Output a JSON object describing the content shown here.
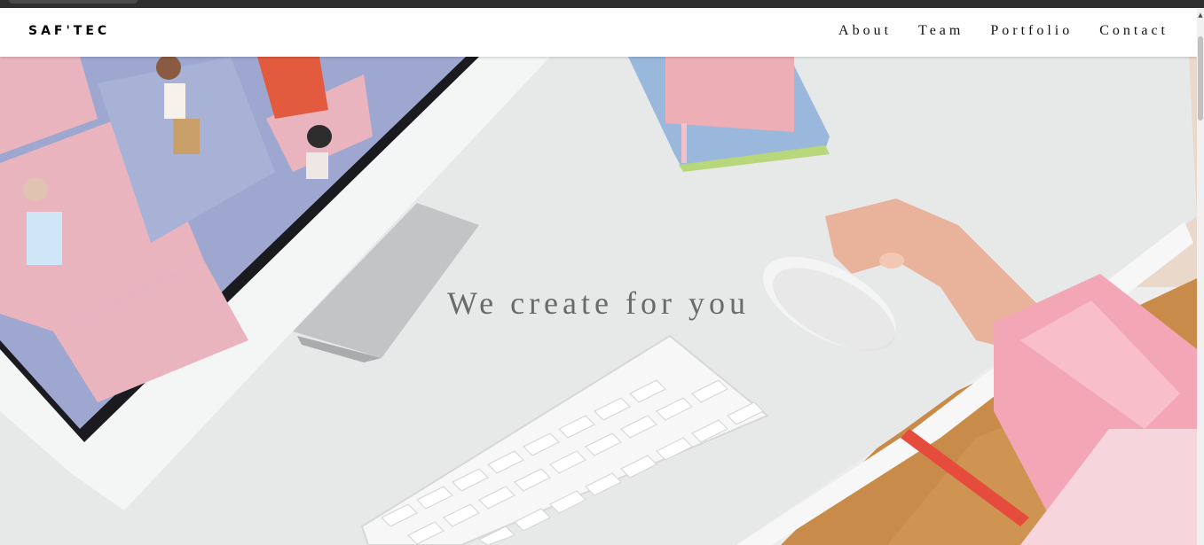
{
  "brand": "SAF'TEC",
  "nav": {
    "about": "About",
    "team": "Team",
    "portfolio": "Portfolio",
    "contact": "Contact"
  },
  "hero": {
    "title": "We create for you"
  },
  "colors": {
    "navbar_bg": "#ffffff",
    "desk": "#e9eaea",
    "sleeve": "#f1a6b5",
    "floor": "#c78a48",
    "accent_red": "#e64c3c"
  },
  "icons": {
    "scroll_up": "▲"
  }
}
